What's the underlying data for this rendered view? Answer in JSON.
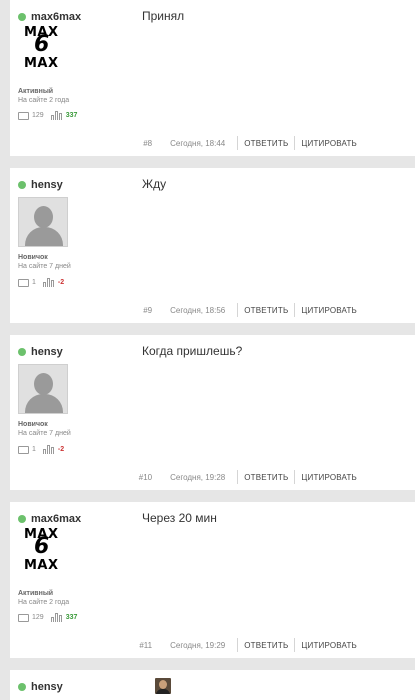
{
  "posts": [
    {
      "author": "max6max",
      "message": "Принял",
      "avatar": "max6max-logo",
      "logo_text": [
        "MAX",
        "6",
        "MAX"
      ],
      "rank": "Активный",
      "since": "На сайте 2 года",
      "comments": "129",
      "reputation": "337",
      "number": "#8",
      "time": "Сегодня, 18:44"
    },
    {
      "author": "hensy",
      "message": "Жду",
      "avatar": "default-silhouette",
      "rank": "Новичок",
      "since": "На сайте 7 дней",
      "comments": "1",
      "reputation": "-2",
      "number": "#9",
      "time": "Сегодня, 18:56"
    },
    {
      "author": "hensy",
      "message": "Когда пришлешь?",
      "avatar": "default-silhouette",
      "rank": "Новичок",
      "since": "На сайте 7 дней",
      "comments": "1",
      "reputation": "-2",
      "number": "#10",
      "time": "Сегодня, 19:28"
    },
    {
      "author": "max6max",
      "message": "Через 20 мин",
      "avatar": "max6max-logo",
      "logo_text": [
        "MAX",
        "6",
        "MAX"
      ],
      "rank": "Активный",
      "since": "На сайте 2 года",
      "comments": "129",
      "reputation": "337",
      "number": "#11",
      "time": "Сегодня, 19:29"
    },
    {
      "author": "hensy",
      "avatar": "small-face-image"
    }
  ],
  "actions": {
    "reply": "ОТВЕТИТЬ",
    "quote": "ЦИТИРОВАТЬ"
  },
  "colors": {
    "online": "#6cc16c",
    "rep_positive": "#3a9a3a",
    "rep_negative": "#cc3333",
    "page_bg": "#e6e6e6"
  }
}
